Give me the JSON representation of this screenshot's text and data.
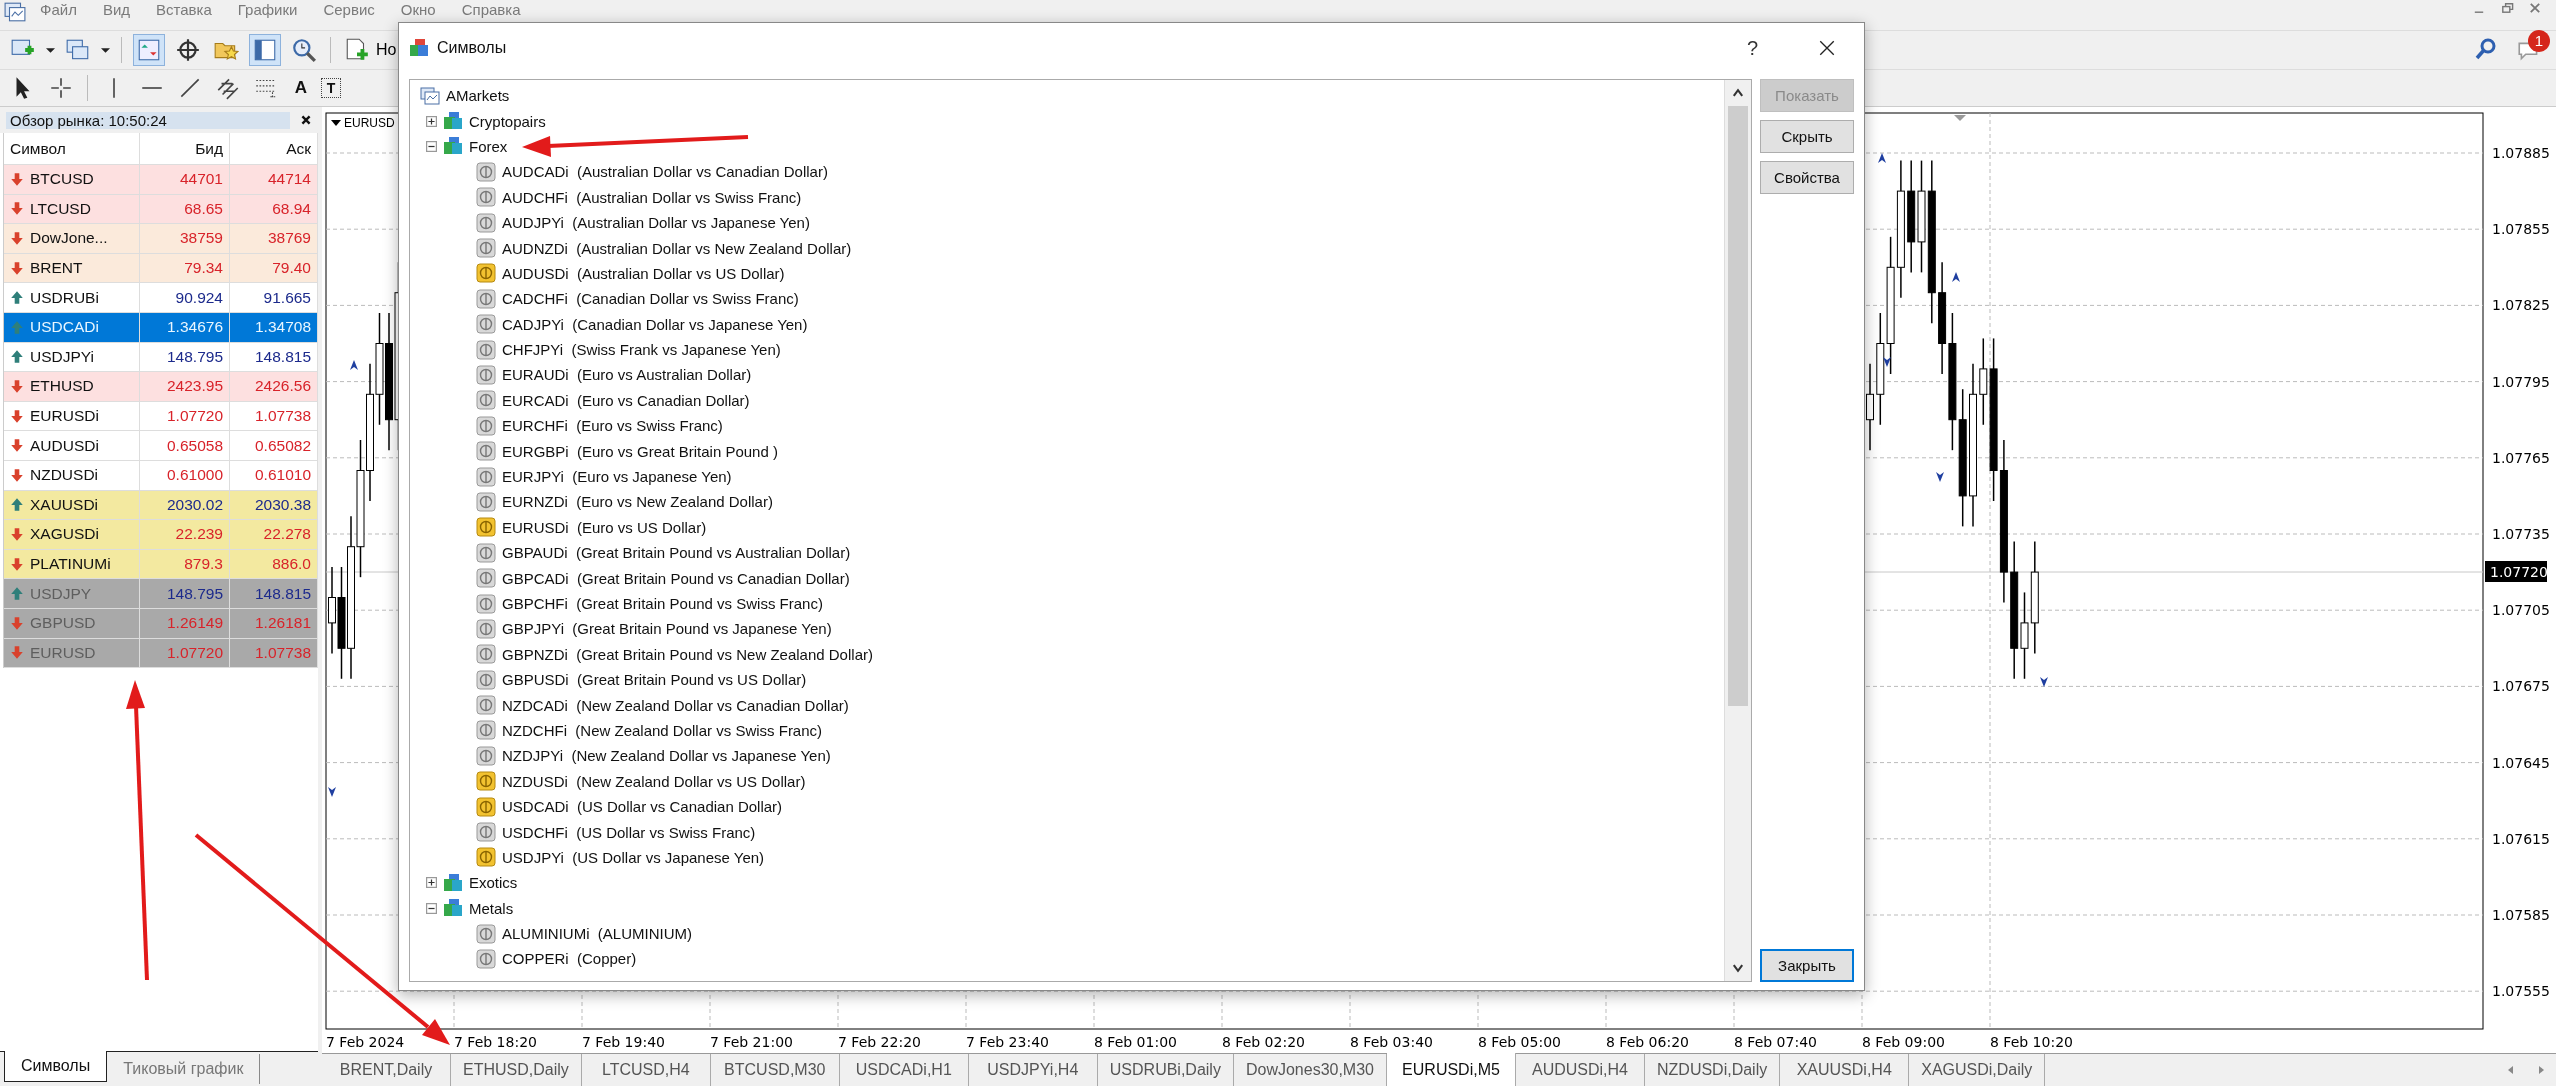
{
  "menu": [
    "Файл",
    "Вид",
    "Вставка",
    "Графики",
    "Сервис",
    "Окно",
    "Справка"
  ],
  "toolbar": {
    "new_order_label": "Но",
    "text_tool": "A",
    "label_tool": "T"
  },
  "notifications": {
    "badge": "1"
  },
  "market_watch": {
    "title": "Обзор рынка: 10:50:24",
    "columns": [
      "Символ",
      "Бид",
      "Аск"
    ],
    "rows": [
      {
        "symbol": "BTCUSD",
        "bid": "44701",
        "ask": "44714",
        "rising": false,
        "color": "#fde0e0",
        "selected": false,
        "disabled": false
      },
      {
        "symbol": "LTCUSD",
        "bid": "68.65",
        "ask": "68.94",
        "rising": false,
        "color": "#fde0e0",
        "selected": false,
        "disabled": false
      },
      {
        "symbol": "DowJone...",
        "bid": "38759",
        "ask": "38769",
        "rising": false,
        "color": "#fbeadb",
        "selected": false,
        "disabled": false
      },
      {
        "symbol": "BRENT",
        "bid": "79.34",
        "ask": "79.40",
        "rising": false,
        "color": "#fbeadb",
        "selected": false,
        "disabled": false
      },
      {
        "symbol": "USDRUBi",
        "bid": "90.924",
        "ask": "91.665",
        "rising": true,
        "color": "#ffffff",
        "selected": false,
        "disabled": false
      },
      {
        "symbol": "USDCADi",
        "bid": "1.34676",
        "ask": "1.34708",
        "rising": true,
        "selected": true,
        "disabled": false
      },
      {
        "symbol": "USDJPYi",
        "bid": "148.795",
        "ask": "148.815",
        "rising": true,
        "color": "#ffffff",
        "selected": false,
        "disabled": false
      },
      {
        "symbol": "ETHUSD",
        "bid": "2423.95",
        "ask": "2426.56",
        "rising": false,
        "color": "#fde0e0",
        "selected": false,
        "disabled": false
      },
      {
        "symbol": "EURUSDi",
        "bid": "1.07720",
        "ask": "1.07738",
        "rising": false,
        "color": "#ffffff",
        "selected": false,
        "disabled": false
      },
      {
        "symbol": "AUDUSDi",
        "bid": "0.65058",
        "ask": "0.65082",
        "rising": false,
        "color": "#ffffff",
        "selected": false,
        "disabled": false
      },
      {
        "symbol": "NZDUSDi",
        "bid": "0.61000",
        "ask": "0.61010",
        "rising": false,
        "color": "#ffffff",
        "selected": false,
        "disabled": false
      },
      {
        "symbol": "XAUUSDi",
        "bid": "2030.02",
        "ask": "2030.38",
        "rising": true,
        "color": "#f3e9a0",
        "selected": false,
        "disabled": false
      },
      {
        "symbol": "XAGUSDi",
        "bid": "22.239",
        "ask": "22.278",
        "rising": false,
        "color": "#f3e9a0",
        "selected": false,
        "disabled": false
      },
      {
        "symbol": "PLATINUMi",
        "bid": "879.3",
        "ask": "886.0",
        "rising": false,
        "color": "#f3e9a0",
        "selected": false,
        "disabled": false
      },
      {
        "symbol": "USDJPY",
        "bid": "148.795",
        "ask": "148.815",
        "rising": true,
        "color": "#a9a9a9",
        "selected": false,
        "disabled": true
      },
      {
        "symbol": "GBPUSD",
        "bid": "1.26149",
        "ask": "1.26181",
        "rising": false,
        "color": "#a9a9a9",
        "selected": false,
        "disabled": true
      },
      {
        "symbol": "EURUSD",
        "bid": "1.07720",
        "ask": "1.07738",
        "rising": false,
        "color": "#a9a9a9",
        "selected": false,
        "disabled": true
      }
    ],
    "tabs": [
      {
        "label": "Символы",
        "selected": true
      },
      {
        "label": "Тиковый график",
        "selected": false
      }
    ]
  },
  "chart": {
    "symbol_label": "EURUSD",
    "price_labels": [
      "1.07885",
      "1.07855",
      "1.07825",
      "1.07795",
      "1.07765",
      "1.07735",
      "1.07705",
      "1.07675",
      "1.07645",
      "1.07615",
      "1.07585",
      "1.07555"
    ],
    "current_price": "1.07720",
    "time_labels": [
      "7 Feb 2024",
      "7 Feb 18:20",
      "7 Feb 19:40",
      "7 Feb 21:00",
      "7 Feb 22:20",
      "7 Feb 23:40",
      "8 Feb 01:00",
      "8 Feb 02:20",
      "8 Feb 03:40",
      "8 Feb 05:00",
      "8 Feb 06:20",
      "8 Feb 07:40",
      "8 Feb 09:00",
      "8 Feb 10:20"
    ]
  },
  "chart_tabs": [
    {
      "label": "BRENT,Daily",
      "selected": false
    },
    {
      "label": "ETHUSD,Daily",
      "selected": false
    },
    {
      "label": "LTCUSD,H4",
      "selected": false
    },
    {
      "label": "BTCUSD,M30",
      "selected": false
    },
    {
      "label": "USDCADi,H1",
      "selected": false
    },
    {
      "label": "USDJPYi,H4",
      "selected": false
    },
    {
      "label": "USDRUBi,Daily",
      "selected": false
    },
    {
      "label": "DowJones30,M30",
      "selected": false
    },
    {
      "label": "EURUSDi,M5",
      "selected": true
    },
    {
      "label": "AUDUSDi,H4",
      "selected": false
    },
    {
      "label": "NZDUSDi,Daily",
      "selected": false
    },
    {
      "label": "XAUUSDi,H4",
      "selected": false
    },
    {
      "label": "XAGUSDi,Daily",
      "selected": false
    }
  ],
  "dialog": {
    "title": "Символы",
    "help": "?",
    "tree": {
      "label": "AMarkets",
      "children": [
        {
          "label": "Cryptopairs",
          "expanded": false
        },
        {
          "label": "Forex",
          "expanded": true,
          "children": [
            {
              "symbol": "AUDCADi",
              "description": "(Australian Dollar vs Canadian Dollar)",
              "shown": false
            },
            {
              "symbol": "AUDCHFi",
              "description": "(Australian Dollar vs Swiss Franc)",
              "shown": false
            },
            {
              "symbol": "AUDJPYi",
              "description": "(Australian Dollar vs Japanese Yen)",
              "shown": false
            },
            {
              "symbol": "AUDNZDi",
              "description": "(Australian Dollar vs New Zealand Dollar)",
              "shown": false
            },
            {
              "symbol": "AUDUSDi",
              "description": "(Australian Dollar vs US Dollar)",
              "shown": true
            },
            {
              "symbol": "CADCHFi",
              "description": "(Canadian Dollar vs Swiss Franc)",
              "shown": false
            },
            {
              "symbol": "CADJPYi",
              "description": "(Canadian Dollar vs Japanese Yen)",
              "shown": false
            },
            {
              "symbol": "CHFJPYi",
              "description": "(Swiss Frank vs Japanese Yen)",
              "shown": false
            },
            {
              "symbol": "EURAUDi",
              "description": "(Euro vs Australian Dollar)",
              "shown": false
            },
            {
              "symbol": "EURCADi",
              "description": "(Euro vs Canadian Dollar)",
              "shown": false
            },
            {
              "symbol": "EURCHFi",
              "description": "(Euro vs Swiss Franc)",
              "shown": false
            },
            {
              "symbol": "EURGBPi",
              "description": "(Euro vs Great Britain Pound )",
              "shown": false
            },
            {
              "symbol": "EURJPYi",
              "description": "(Euro vs Japanese Yen)",
              "shown": false
            },
            {
              "symbol": "EURNZDi",
              "description": "(Euro vs New Zealand Dollar)",
              "shown": false
            },
            {
              "symbol": "EURUSDi",
              "description": "(Euro vs US Dollar)",
              "shown": true
            },
            {
              "symbol": "GBPAUDi",
              "description": "(Great Britain Pound vs Australian Dollar)",
              "shown": false
            },
            {
              "symbol": "GBPCADi",
              "description": "(Great Britain Pound vs Canadian Dollar)",
              "shown": false
            },
            {
              "symbol": "GBPCHFi",
              "description": "(Great Britain Pound vs Swiss Franc)",
              "shown": false
            },
            {
              "symbol": "GBPJPYi",
              "description": "(Great Britain Pound vs Japanese Yen)",
              "shown": false
            },
            {
              "symbol": "GBPNZDi",
              "description": "(Great Britain Pound vs New Zealand Dollar)",
              "shown": false
            },
            {
              "symbol": "GBPUSDi",
              "description": "(Great Britain Pound vs US Dollar)",
              "shown": false
            },
            {
              "symbol": "NZDCADi",
              "description": "(New Zealand Dollar vs Canadian Dollar)",
              "shown": false
            },
            {
              "symbol": "NZDCHFi",
              "description": "(New Zealand Dollar vs Swiss Franc)",
              "shown": false
            },
            {
              "symbol": "NZDJPYi",
              "description": "(New Zealand Dollar vs Japanese Yen)",
              "shown": false
            },
            {
              "symbol": "NZDUSDi",
              "description": "(New Zealand Dollar vs US Dollar)",
              "shown": true
            },
            {
              "symbol": "USDCADi",
              "description": "(US Dollar vs Canadian Dollar)",
              "shown": true
            },
            {
              "symbol": "USDCHFi",
              "description": "(US Dollar vs Swiss Franc)",
              "shown": false
            },
            {
              "symbol": "USDJPYi",
              "description": "(US Dollar vs Japanese Yen)",
              "shown": true
            }
          ]
        },
        {
          "label": "Exotics",
          "expanded": false
        },
        {
          "label": "Metals",
          "expanded": true,
          "children": [
            {
              "symbol": "ALUMINIUMi",
              "description": "(ALUMINIUM)",
              "shown": false
            },
            {
              "symbol": "COPPERi",
              "description": "(Copper)",
              "shown": false
            }
          ]
        }
      ]
    },
    "buttons": [
      {
        "label": "Показать",
        "disabled": true,
        "default": false
      },
      {
        "label": "Скрыть",
        "disabled": false,
        "default": false
      },
      {
        "label": "Свойства",
        "disabled": false,
        "default": false
      },
      {
        "label": "Закрыть",
        "disabled": false,
        "default": true
      }
    ]
  }
}
